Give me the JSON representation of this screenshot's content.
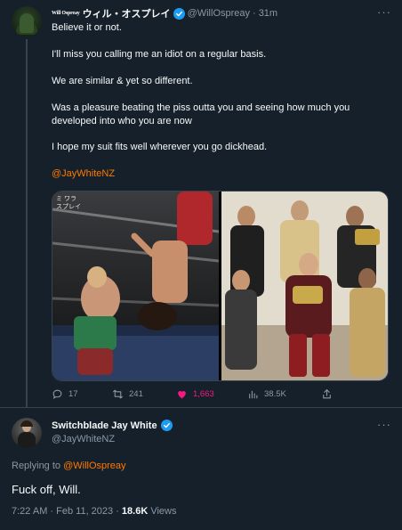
{
  "tweet": {
    "logo_text": "Will Ospreay",
    "display_name": "ウィル・オスプレイ",
    "handle": "@WillOspreay",
    "separator": "·",
    "time": "31m",
    "paragraphs": [
      "Believe it or not.",
      "I'll miss you calling me an idiot on a regular basis.",
      "We are similar & yet so different.",
      "Was a pleasure beating the piss outta you and seeing how much you developed into who you are now",
      "I hope my suit fits well wherever you go dickhead."
    ],
    "mention": "@JayWhiteNZ",
    "media": {
      "left_watermark_line1": "ミ ワラ",
      "left_watermark_line2": "スプレイ"
    },
    "stats": {
      "replies": "17",
      "retweets": "241",
      "likes": "1,663",
      "views": "38.5K"
    }
  },
  "reply": {
    "display_name": "Switchblade Jay White",
    "handle": "@JayWhiteNZ",
    "replying_prefix": "Replying to ",
    "replying_to": "@WillOspreay",
    "text": "Fuck off, Will.",
    "timestamp": "7:22 AM · Feb 11, 2023 · ",
    "views_count": "18.6K",
    "views_label": " Views"
  },
  "colors": {
    "background": "#15202b",
    "text": "#f7f9f9",
    "secondary": "#8b98a5",
    "mention": "#ff7a00",
    "verified": "#1d9bf0",
    "like": "#f91880",
    "border": "#38444d"
  },
  "icons": [
    "more-icon",
    "verified-badge-icon",
    "reply-icon",
    "retweet-icon",
    "like-icon",
    "views-icon"
  ]
}
